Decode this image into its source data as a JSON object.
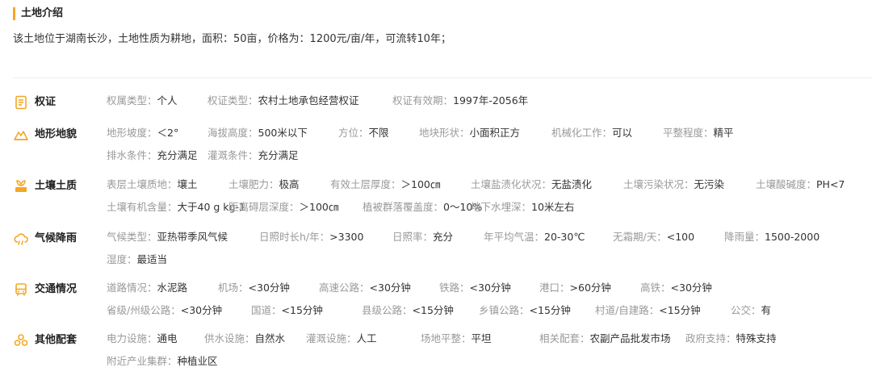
{
  "header": {
    "title": "土地介绍"
  },
  "intro": "该土地位于湖南长沙，土地性质为耕地，面积：50亩，价格为：1200元/亩/年，可流转10年；",
  "colors": {
    "accent": "#f5a623",
    "label": "#999999",
    "value": "#333333"
  },
  "sections": [
    {
      "name": "权证",
      "icon": "document-icon",
      "rows": [
        [
          {
            "k": "权属类型：",
            "v": "个人"
          },
          {
            "k": "权证类型：",
            "v": "农村土地承包经营权证"
          },
          {
            "k": "权证有效期：",
            "v": "1997年-2056年"
          }
        ]
      ]
    },
    {
      "name": "地形地貌",
      "icon": "terrain-icon",
      "rows": [
        [
          {
            "k": "地形坡度：",
            "v": "＜2°"
          },
          {
            "k": "海拔高度：",
            "v": "500米以下"
          },
          {
            "k": "方位：",
            "v": "不限"
          },
          {
            "k": "地块形状：",
            "v": "小面积正方"
          },
          {
            "k": "机械化工作：",
            "v": "可以"
          },
          {
            "k": "平整程度：",
            "v": "精平"
          }
        ],
        [
          {
            "k": "排水条件：",
            "v": "充分满足"
          },
          {
            "k": "灌溉条件：",
            "v": "充分满足"
          }
        ]
      ]
    },
    {
      "name": "土壤土质",
      "icon": "soil-icon",
      "rows": [
        [
          {
            "k": "表层土壤质地：",
            "v": "壤土"
          },
          {
            "k": "土壤肥力：",
            "v": "极高"
          },
          {
            "k": "有效土层厚度：",
            "v": "＞100㎝"
          },
          {
            "k": "土壤盐渍化状况：",
            "v": "无盐渍化"
          },
          {
            "k": "土壤污染状况：",
            "v": "无污染"
          },
          {
            "k": "土壤酸碱度：",
            "v": "PH<7"
          }
        ],
        [
          {
            "k": "土壤有机含量：",
            "v": "大于40 g kg-1"
          },
          {
            "k": "距离碍层深度：",
            "v": "＞100㎝"
          },
          {
            "k": "植被群落覆盖度：",
            "v": "0～10%"
          },
          {
            "k": "地下水埋深：",
            "v": "10米左右"
          }
        ]
      ]
    },
    {
      "name": "气候降雨",
      "icon": "cloud-icon",
      "rows": [
        [
          {
            "k": "气候类型：",
            "v": "亚热带季风气候"
          },
          {
            "k": "日照时长h/年：",
            "v": ">3300"
          },
          {
            "k": "日照率：",
            "v": "充分"
          },
          {
            "k": "年平均气温：",
            "v": "20-30℃"
          },
          {
            "k": "无霜期/天：",
            "v": "<100"
          },
          {
            "k": "降雨量：",
            "v": "1500-2000"
          }
        ],
        [
          {
            "k": "湿度：",
            "v": "最适当"
          }
        ]
      ]
    },
    {
      "name": "交通情况",
      "icon": "bus-icon",
      "rows": [
        [
          {
            "k": "道路情况：",
            "v": "水泥路"
          },
          {
            "k": "机场：",
            "v": "<30分钟"
          },
          {
            "k": "高速公路：",
            "v": "<30分钟"
          },
          {
            "k": "铁路：",
            "v": "<30分钟"
          },
          {
            "k": "港口：",
            "v": ">60分钟"
          },
          {
            "k": "高铁：",
            "v": "<30分钟"
          }
        ],
        [
          {
            "k": "省级/州级公路：",
            "v": "<30分钟"
          },
          {
            "k": "国道：",
            "v": "<15分钟"
          },
          {
            "k": "县级公路：",
            "v": "<15分钟"
          },
          {
            "k": "乡镇公路：",
            "v": "<15分钟"
          },
          {
            "k": "村道/自建路：",
            "v": "<15分钟"
          },
          {
            "k": "公交：",
            "v": "有"
          }
        ]
      ]
    },
    {
      "name": "其他配套",
      "icon": "facilities-icon",
      "rows": [
        [
          {
            "k": "电力设施：",
            "v": "通电"
          },
          {
            "k": "供水设施：",
            "v": "自然水"
          },
          {
            "k": "灌溉设施：",
            "v": "人工"
          },
          {
            "k": "场地平整：",
            "v": "平坦"
          },
          {
            "k": "相关配套：",
            "v": "农副产品批发市场"
          },
          {
            "k": "政府支持：",
            "v": "特殊支持"
          }
        ],
        [
          {
            "k": "附近产业集群：",
            "v": "种植业区"
          }
        ]
      ]
    }
  ]
}
